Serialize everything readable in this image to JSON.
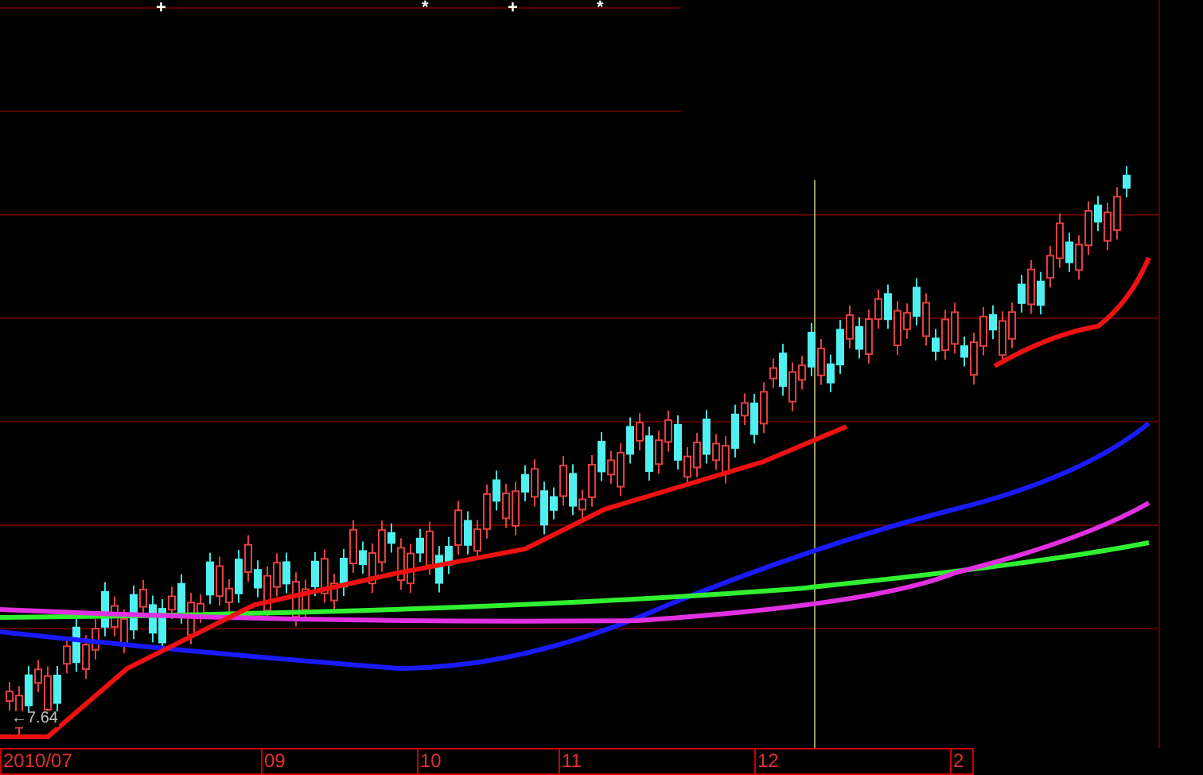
{
  "chart": {
    "top_markers": [
      "+",
      "*",
      "+",
      "*"
    ],
    "price_label": "←7.64",
    "x_axis_labels": [
      "2010/07",
      "09",
      "10",
      "11",
      "12",
      "2"
    ]
  }
}
